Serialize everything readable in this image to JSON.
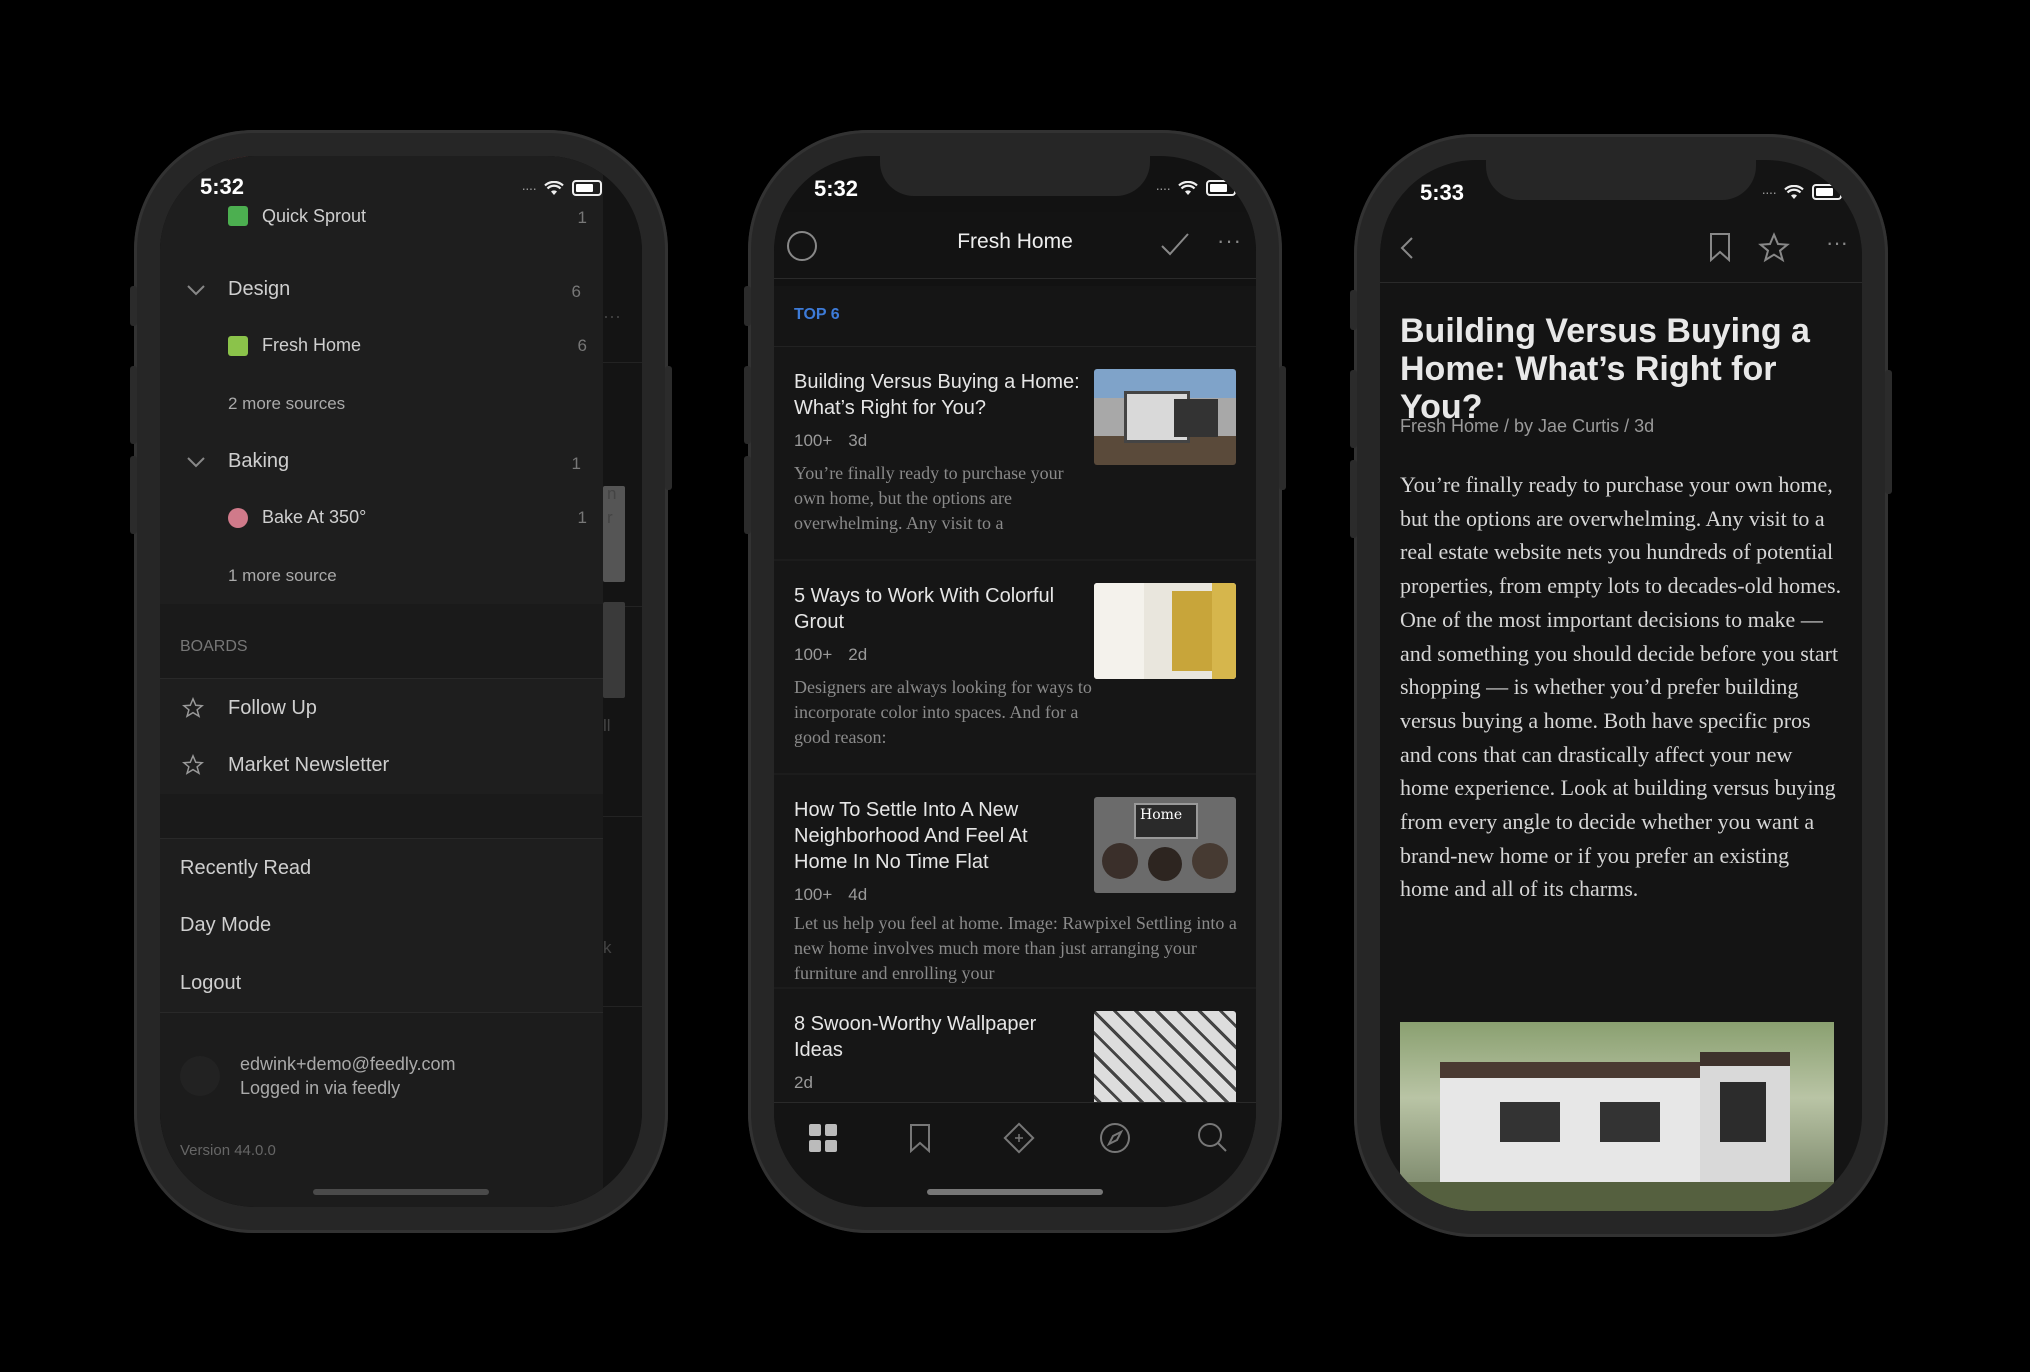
{
  "phone1": {
    "time": "5:32",
    "sources_top": {
      "label": "Quick Sprout",
      "count": "1"
    },
    "groups": [
      {
        "label": "Design",
        "count": "6",
        "sources": [
          {
            "label": "Fresh Home",
            "count": "6"
          }
        ],
        "more": "2 more sources"
      },
      {
        "label": "Baking",
        "count": "1",
        "sources": [
          {
            "label": "Bake At 350°",
            "count": "1"
          }
        ],
        "more": "1 more source"
      }
    ],
    "boards_header": "BOARDS",
    "boards": [
      {
        "label": "Follow Up"
      },
      {
        "label": "Market Newsletter"
      }
    ],
    "menu": [
      {
        "label": "Recently Read"
      },
      {
        "label": "Day Mode"
      },
      {
        "label": "Logout"
      }
    ],
    "account": {
      "email": "edwink+demo@feedly.com",
      "via": "Logged in via feedly"
    },
    "version": "Version 44.0.0",
    "behind_fragments": [
      "n",
      "r",
      "ll",
      "k"
    ]
  },
  "phone2": {
    "time": "5:32",
    "title": "Fresh Home",
    "section": "TOP 6",
    "articles": [
      {
        "title": "Building Versus Buying a Home: What’s Right for You?",
        "count": "100+",
        "age": "3d",
        "summary": "You’re finally ready to purchase your own home, but the options are overwhelming. Any visit to a"
      },
      {
        "title": "5 Ways to Work With Colorful Grout",
        "count": "100+",
        "age": "2d",
        "summary": "Designers are always looking for ways to incorporate color into spaces. And for a good reason:"
      },
      {
        "title": "How To Settle Into A New Neighborhood And Feel At Home In No Time Flat",
        "count": "100+",
        "age": "4d",
        "summary": "Let us help you feel at home. Image: Rawpixel Settling into a new home involves much more than just arranging your furniture and enrolling your"
      },
      {
        "title": "8 Swoon-Worthy Wallpaper Ideas",
        "count": "",
        "age": "2d",
        "summary": ""
      }
    ],
    "thumb_text": "Home",
    "tabs": [
      "grid-icon",
      "bookmark-icon",
      "feed-icon",
      "explore-icon",
      "search-icon"
    ]
  },
  "phone3": {
    "time": "5:33",
    "title": "Building Versus Buying a Home: What’s Right for You?",
    "meta": "Fresh Home / by Jae Curtis / 3d",
    "body": "You’re finally ready to purchase your own home, but the options are overwhelming. Any visit to a real estate website nets you hundreds of potential properties, from empty lots to decades-old homes. One of the most important decisions to make — and something you should decide before you start shopping — is whether you’d prefer building versus buying a home. Both have specific pros and cons that can drastically affect your new home experience. Look at building versus buying from every angle to decide whether you want a brand-new home or if you prefer an existing home and all of its charms."
  },
  "colors": {
    "accent": "#3d7bd8",
    "background": "#000000",
    "panel": "#1c1c1c"
  }
}
